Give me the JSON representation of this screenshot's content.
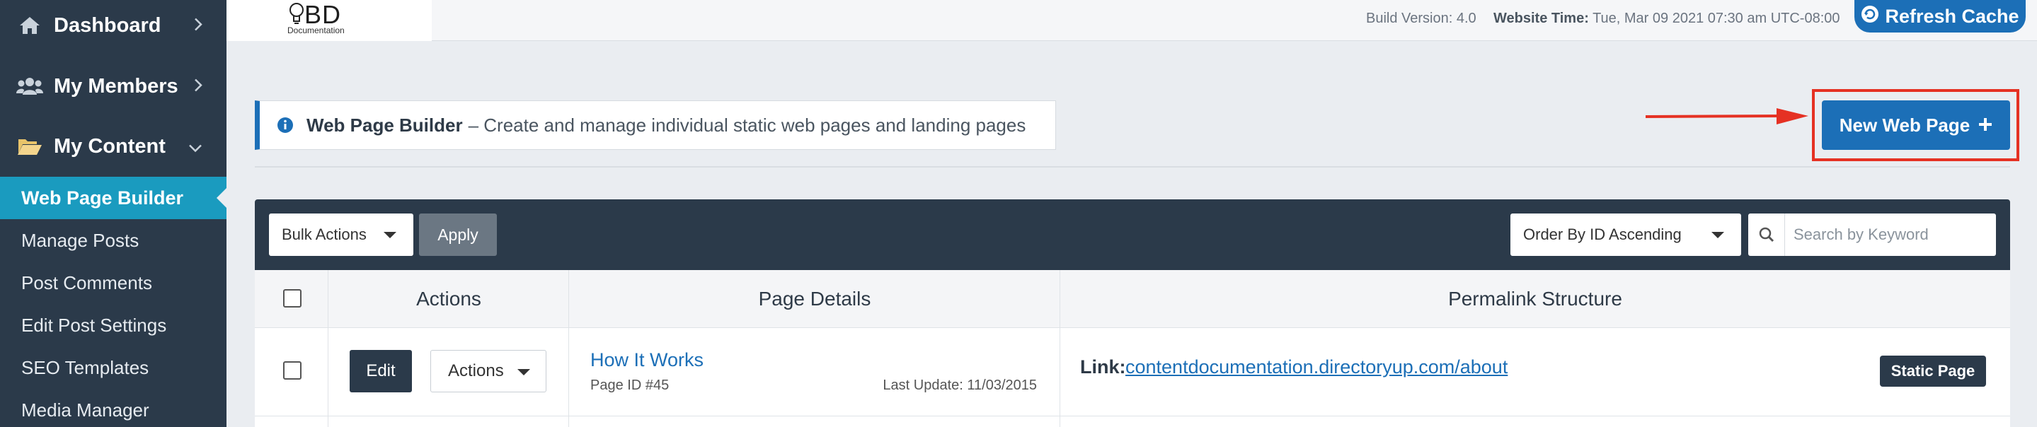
{
  "sidebar": {
    "main_items": [
      {
        "label": "Dashboard",
        "icon": "home-icon"
      },
      {
        "label": "My Members",
        "icon": "users-icon"
      },
      {
        "label": "My Content",
        "icon": "folder-open-icon"
      }
    ],
    "active_item": "Web Page Builder",
    "sub_items": [
      "Manage Posts",
      "Post Comments",
      "Edit Post Settings",
      "SEO Templates",
      "Media Manager"
    ]
  },
  "topbar": {
    "logo_text": "BD",
    "logo_sub": "Documentation",
    "build_version": "Build Version: 4.0",
    "website_time_label": "Website Time:",
    "website_time_value": "Tue, Mar 09 2021 07:30 am UTC-08:00",
    "refresh_label": "Refresh Cache"
  },
  "header": {
    "title": "Web Page Builder",
    "description": "– Create and manage individual static web pages and landing pages",
    "new_button_label": "New Web Page"
  },
  "toolbar": {
    "bulk_actions": "Bulk Actions",
    "apply": "Apply",
    "order_by": "Order By ID Ascending",
    "search_placeholder": "Search by Keyword"
  },
  "table": {
    "columns": [
      "Actions",
      "Page Details",
      "Permalink Structure"
    ],
    "rows": [
      {
        "edit_label": "Edit",
        "actions_label": "Actions",
        "title": "How It Works",
        "page_id": "Page ID #45",
        "last_update": "Last Update: 11/03/2015",
        "link_label": "Link:",
        "link_url": "contentdocumentation.directoryup.com/about",
        "badge": "Static Page"
      }
    ]
  },
  "colors": {
    "sidebar_bg": "#2b3a4a",
    "active_nav": "#1a9bbf",
    "primary_blue": "#1c6fb7",
    "highlight_red": "#e53123"
  }
}
